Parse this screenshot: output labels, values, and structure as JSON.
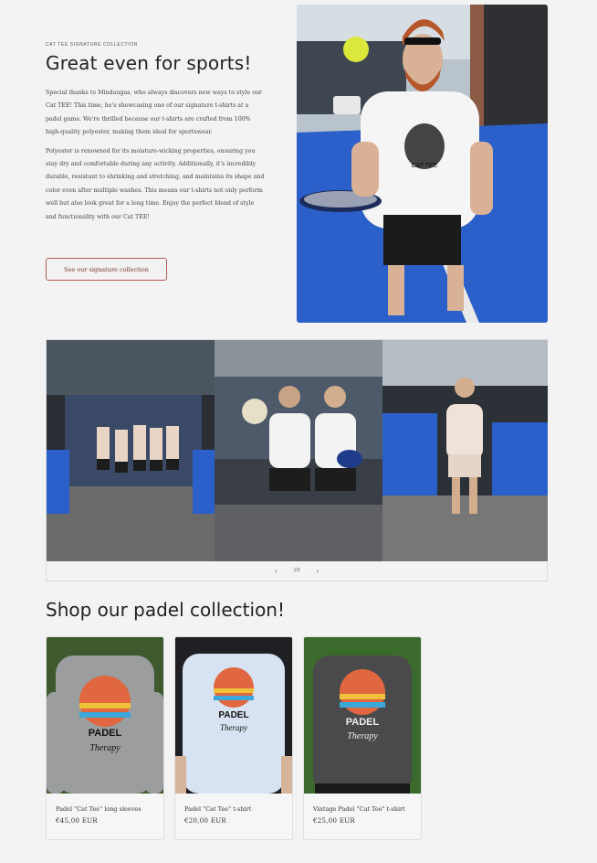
{
  "hero": {
    "eyebrow": "CAT TEE SIGNATURE COLLECTION",
    "title": "Great even for sports!",
    "paragraph1": "Special thanks to Mindaugas, who always discovers new ways to style our Cat TEE! This time, he's showcasing one of our signature t-shirts at a padel game. We're thrilled because our t-shirts are crafted from 100% high-quality polyester, making them ideal for sportswear.",
    "paragraph2": "Polyester is renowned for its moisture-wicking properties, ensuring you stay dry and comfortable during any activity. Additionally, it's incredibly durable, resistant to shrinking and stretching, and maintains its shape and color even after multiple washes. This means our t-shirts not only perform well but also look great for a long time. Enjoy the perfect blend of style and functionality with our Cat TEE!",
    "cta_label": "See our signature collection",
    "shirt_print": "CAT TEE"
  },
  "gallery": {
    "counter": "1/3",
    "prev_icon": "chevron-left-icon",
    "next_icon": "chevron-right-icon"
  },
  "shop": {
    "title": "Shop our padel collection!",
    "products": [
      {
        "name": "Padel \"Cat Tee\" long sleeves",
        "price": "€45,00 EUR",
        "print": "PADEL",
        "print2": "Therapy"
      },
      {
        "name": "Padel \"Cat Tee\" t-shirt",
        "price": "€20,00 EUR",
        "print": "PADEL",
        "print2": "Therapy"
      },
      {
        "name": "Vintage Padel \"Cat Tee\" t-shirt",
        "price": "€25,00 EUR",
        "print": "PADEL",
        "print2": "Therapy"
      }
    ]
  },
  "colors": {
    "court_blue": "#2b5fc9",
    "cta_border": "#b85a5a",
    "background": "#f3f3f3"
  }
}
